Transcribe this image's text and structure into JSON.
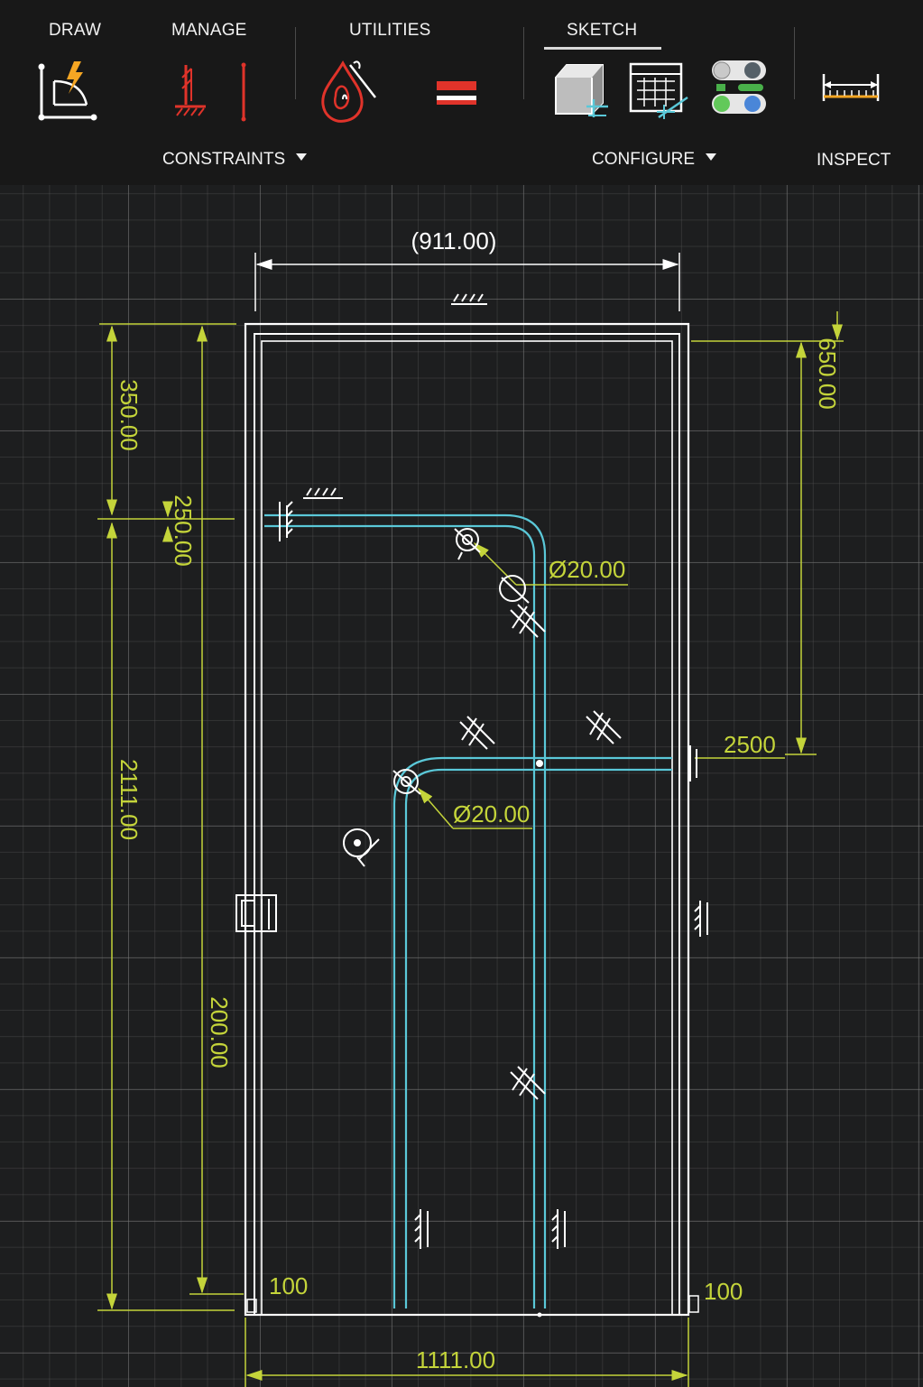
{
  "toolbar": {
    "tabs": [
      {
        "label": "DRAW"
      },
      {
        "label": "MANAGE"
      },
      {
        "label": "UTILITIES"
      },
      {
        "label": "SKETCH",
        "active": true
      }
    ],
    "groups": {
      "constraints": "CONSTRAINTS",
      "configure": "CONFIGURE",
      "inspect": "INSPECT"
    },
    "tools": [
      {
        "icon": "create-sketch-icon",
        "group": "DRAW"
      },
      {
        "icon": "fix-constraint-icon",
        "group": "MANAGE"
      },
      {
        "icon": "vertical-constraint-icon",
        "group": "MANAGE"
      },
      {
        "icon": "fire-drop-icon",
        "group": "UTILITIES"
      },
      {
        "icon": "equal-constraint-icon",
        "group": "UTILITIES"
      },
      {
        "icon": "3d-box-icon",
        "group": "SKETCH"
      },
      {
        "icon": "grid-table-icon",
        "group": "SKETCH"
      },
      {
        "icon": "toggle-settings-icon",
        "group": "SKETCH"
      },
      {
        "icon": "measure-icon",
        "group": "INSPECT"
      }
    ]
  },
  "colors": {
    "background": "#1d1e1f",
    "toolbar": "#181818",
    "geometry": "#ffffff",
    "dimension": "#c4d43a",
    "path": "#5ac8d8",
    "accent_red": "#e0332a",
    "accent_orange": "#f5a623"
  },
  "sketch": {
    "dimensions": {
      "top_width": "(911.00)",
      "bottom_width": "1111.00",
      "left_top": "350.00",
      "left_small": "250.00",
      "left_total": "2111.00",
      "left_inner": "200.00",
      "right_top": "650.00",
      "right_mid": "2500",
      "diameter_upper": "Ø20.00",
      "diameter_lower": "Ø20.00",
      "bottom_left": "100",
      "bottom_right": "100"
    }
  }
}
